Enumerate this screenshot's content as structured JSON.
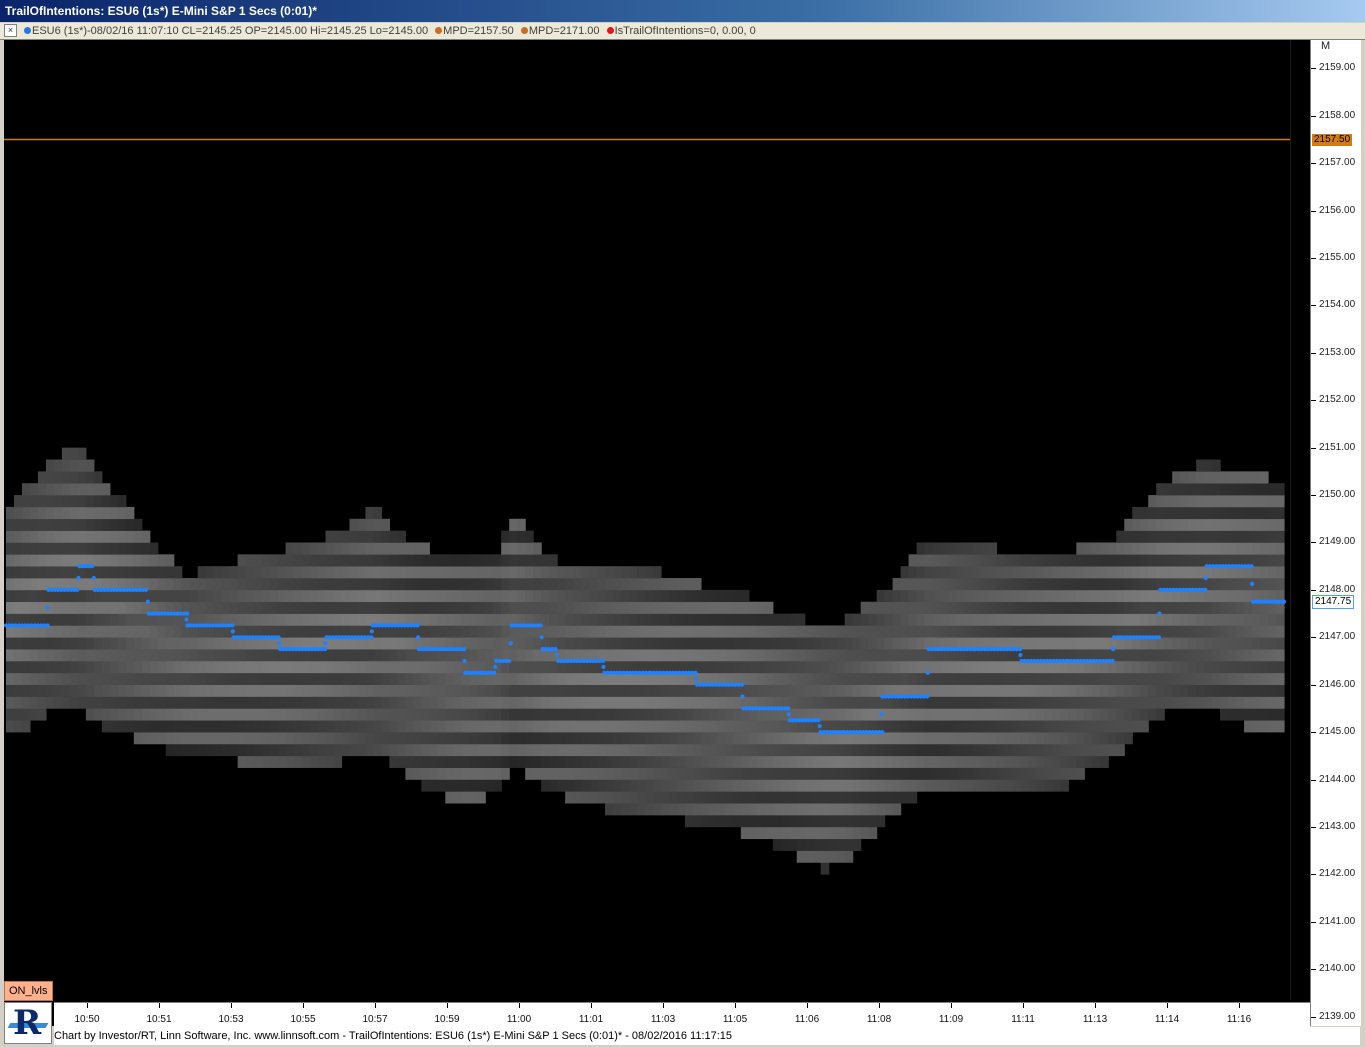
{
  "window": {
    "title": "TrailOfIntentions: ESU6 (1s*) E-Mini S&P 1 Secs (0:01)*"
  },
  "infobar": {
    "close_glyph": "×",
    "symbol_info": "ESU6 (1s*)-08/02/16 11:07:10 CL=2145.25 OP=2145.00 Hi=2145.25 Lo=2145.00",
    "mpd1": "MPD=2157.50",
    "mpd2": "MPD=2171.00",
    "trail": "IsTrailOfIntentions=0, 0.00, 0",
    "colors": {
      "symbol_dot": "#1e78e6",
      "mpd1_dot": "#c86e1e",
      "mpd2_dot": "#c86e1e",
      "trail_dot": "#e01818"
    }
  },
  "price_axis": {
    "unit_label": "M",
    "ticks": [
      "2159.00",
      "2158.00",
      "2157.00",
      "2156.00",
      "2155.00",
      "2154.00",
      "2153.00",
      "2152.00",
      "2151.00",
      "2150.00",
      "2149.00",
      "2148.00",
      "2147.00",
      "2146.00",
      "2145.00",
      "2144.00",
      "2143.00",
      "2142.00",
      "2141.00",
      "2140.00",
      "2139.00"
    ],
    "mpd_badge": "2157.50",
    "current_badge": "2147.75"
  },
  "time_axis": {
    "labels": [
      "10:50",
      "10:51",
      "10:53",
      "10:55",
      "10:57",
      "10:59",
      "11:00",
      "11:01",
      "11:03",
      "11:05",
      "11:06",
      "11:08",
      "11:09",
      "11:11",
      "11:13",
      "11:14",
      "11:16"
    ]
  },
  "chart_data": {
    "type": "scatter",
    "title": "TrailOfIntentions: ESU6 (1s*) E-Mini S&P 1 Secs (0:01)*",
    "ylim": [
      2138.8,
      2159.6
    ],
    "mpd_level": 2157.5,
    "last_price": 2147.75,
    "colors": {
      "trail": "#1e82ff",
      "mpd_line": "#d37a14",
      "band": "#8a8a8a"
    },
    "x": [
      "10:49:05",
      "10:50:00",
      "10:50:40",
      "10:51:00",
      "10:52:10",
      "10:53:00",
      "10:54:00",
      "10:55:00",
      "10:56:00",
      "10:57:00",
      "10:58:00",
      "10:59:00",
      "10:59:40",
      "11:00:00",
      "11:00:40",
      "11:01:00",
      "11:02:00",
      "11:03:00",
      "11:04:00",
      "11:05:00",
      "11:06:00",
      "11:06:40",
      "11:07:10",
      "11:08:00",
      "11:09:00",
      "11:10:00",
      "11:11:00",
      "11:12:00",
      "11:13:00",
      "11:14:00",
      "11:15:00",
      "11:16:00",
      "11:16:40"
    ],
    "series": [
      {
        "values": [
          2147.25,
          2148.0,
          2148.5,
          2148.0,
          2147.5,
          2147.25,
          2147.0,
          2146.75,
          2147.0,
          2147.25,
          2146.75,
          2146.25,
          2146.5,
          2147.25,
          2146.75,
          2146.5,
          2146.25,
          2146.25,
          2146.0,
          2145.5,
          2145.25,
          2145.0,
          2145.0,
          2145.75,
          2146.75,
          2146.75,
          2146.5,
          2146.5,
          2147.0,
          2148.0,
          2148.5,
          2147.75,
          2147.75
        ]
      }
    ],
    "band_upper": [
      2149.5,
      2150.6,
      2151.0,
      2150.5,
      2149.0,
      2148.2,
      2148.5,
      2148.7,
      2149.0,
      2149.6,
      2148.8,
      2148.6,
      2148.7,
      2149.5,
      2148.7,
      2148.5,
      2148.5,
      2148.3,
      2148.0,
      2147.8,
      2147.3,
      2147.2,
      2147.2,
      2147.8,
      2149.0,
      2148.9,
      2148.6,
      2148.7,
      2149.0,
      2150.1,
      2150.6,
      2150.3,
      2150.2
    ],
    "band_lower": [
      2145.0,
      2145.5,
      2145.7,
      2145.3,
      2144.9,
      2144.6,
      2144.5,
      2144.3,
      2144.4,
      2144.7,
      2144.0,
      2143.6,
      2143.8,
      2144.5,
      2144.0,
      2143.8,
      2143.5,
      2143.4,
      2143.2,
      2143.0,
      2142.6,
      2142.2,
      2142.3,
      2143.2,
      2144.0,
      2143.9,
      2143.8,
      2144.0,
      2144.6,
      2145.5,
      2145.7,
      2145.1,
      2145.0
    ]
  },
  "on_lvls_label": "ON_lvls",
  "footer": {
    "text": "Chart by Investor/RT, Linn Software, Inc. www.linnsoft.com - TrailOfIntentions: ESU6 (1s*) E-Mini S&P 1 Secs (0:01)* - 08/02/2016 11:17:15"
  }
}
